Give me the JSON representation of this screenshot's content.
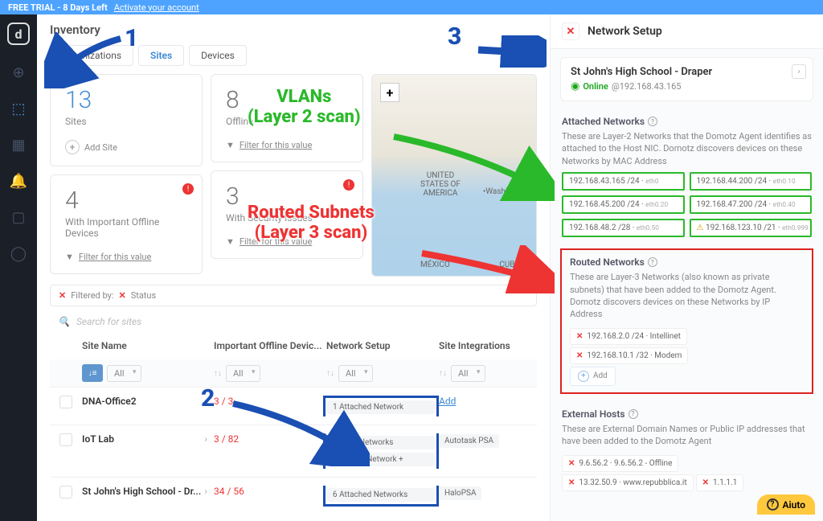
{
  "banner": {
    "trial": "FREE TRIAL - 8 Days Left",
    "activate": "Activate your account"
  },
  "nav": {
    "logo": "d"
  },
  "page": {
    "title": "Inventory"
  },
  "tabs": {
    "org": "Organizations",
    "sites": "Sites",
    "devices": "Devices"
  },
  "cards": {
    "sites": {
      "num": "13",
      "label": "Sites",
      "action": "Add Site"
    },
    "offline": {
      "num": "8",
      "label": "Offline",
      "action": "Filter for this value"
    },
    "important": {
      "num": "4",
      "label": "With Important Offline Devices",
      "action": "Filter for this value"
    },
    "security": {
      "num": "3",
      "label": "With Security Issues",
      "action": "Filter for this value"
    }
  },
  "map": {
    "country": "UNITED\nSTATES OF\nAMERICA",
    "mexico": "MÉXICO",
    "cuba": "CUBA",
    "washington": "Washington"
  },
  "filter": {
    "label": "Filtered by:",
    "chip": "Status"
  },
  "search": {
    "placeholder": "Search for sites"
  },
  "columns": {
    "name": "Site Name",
    "off": "Important Offline Devic...",
    "net": "Network Setup",
    "int": "Site Integrations",
    "all": "All"
  },
  "rows": [
    {
      "name": "DNA-Office2",
      "off": "3 / 3",
      "net": [
        "1 Attached Network"
      ],
      "int": "Add",
      "int_link": true
    },
    {
      "name": "IoT Lab",
      "off": "3 / 82",
      "net": [
        "tached Networks",
        "1 Routed Network  +"
      ],
      "int": "Autotask PSA",
      "int_link": false
    },
    {
      "name": "St John's High School - Dr...",
      "off": "34 / 56",
      "net": [
        "6 Attached Networks"
      ],
      "int": "HaloPSA",
      "int_link": false
    }
  ],
  "panel": {
    "title": "Network Setup",
    "site": {
      "name": "St John's High School - Draper",
      "status_txt": "Online",
      "ip": "@192.168.43.165"
    },
    "attached": {
      "heading": "Attached Networks",
      "desc": "These are Layer-2 Networks that the Domotz Agent identifies as attached to the Host NIC. Domotz discovers devices on these Networks by MAC Address",
      "items": [
        {
          "ip": "192.168.43.165 /24",
          "if": "eth0"
        },
        {
          "ip": "192.168.44.200 /24",
          "if": "eth0.10"
        },
        {
          "ip": "192.168.45.200 /24",
          "if": "eth0.20"
        },
        {
          "ip": "192.168.47.200 /24",
          "if": "eth0.40"
        },
        {
          "ip": "192.168.48.2 /28",
          "if": "eth0.50"
        },
        {
          "ip": "192.168.123.10 /21",
          "if": "eth0.999",
          "warn": true
        }
      ]
    },
    "routed": {
      "heading": "Routed Networks",
      "desc": "These are Layer-3 Networks (also known as private subnets) that have been added to the Domotz Agent. Domotz discovers devices on these Networks by IP Address",
      "items": [
        {
          "ip": "192.168.2.0 /24",
          "label": "Intellinet"
        },
        {
          "ip": "192.168.10.1 /32",
          "label": "Modem"
        }
      ],
      "add": "Add"
    },
    "external": {
      "heading": "External Hosts",
      "desc": "These are External Domain Names or Public IP addresses that have been added to the Domotz Agent",
      "items": [
        {
          "txt": "9.6.56.2 · 9.6.56.2 - Offline"
        },
        {
          "txt": "13.32.50.9 · www.repubblica.it"
        },
        {
          "txt": "1.1.1.1"
        }
      ]
    }
  },
  "overlays": {
    "n1": "1",
    "n2": "2",
    "n3": "3",
    "vlans": "VLANs\n(Layer 2 scan)",
    "routed": "Routed Subnets\n(Layer 3 scan)"
  },
  "help": "Aiuto"
}
